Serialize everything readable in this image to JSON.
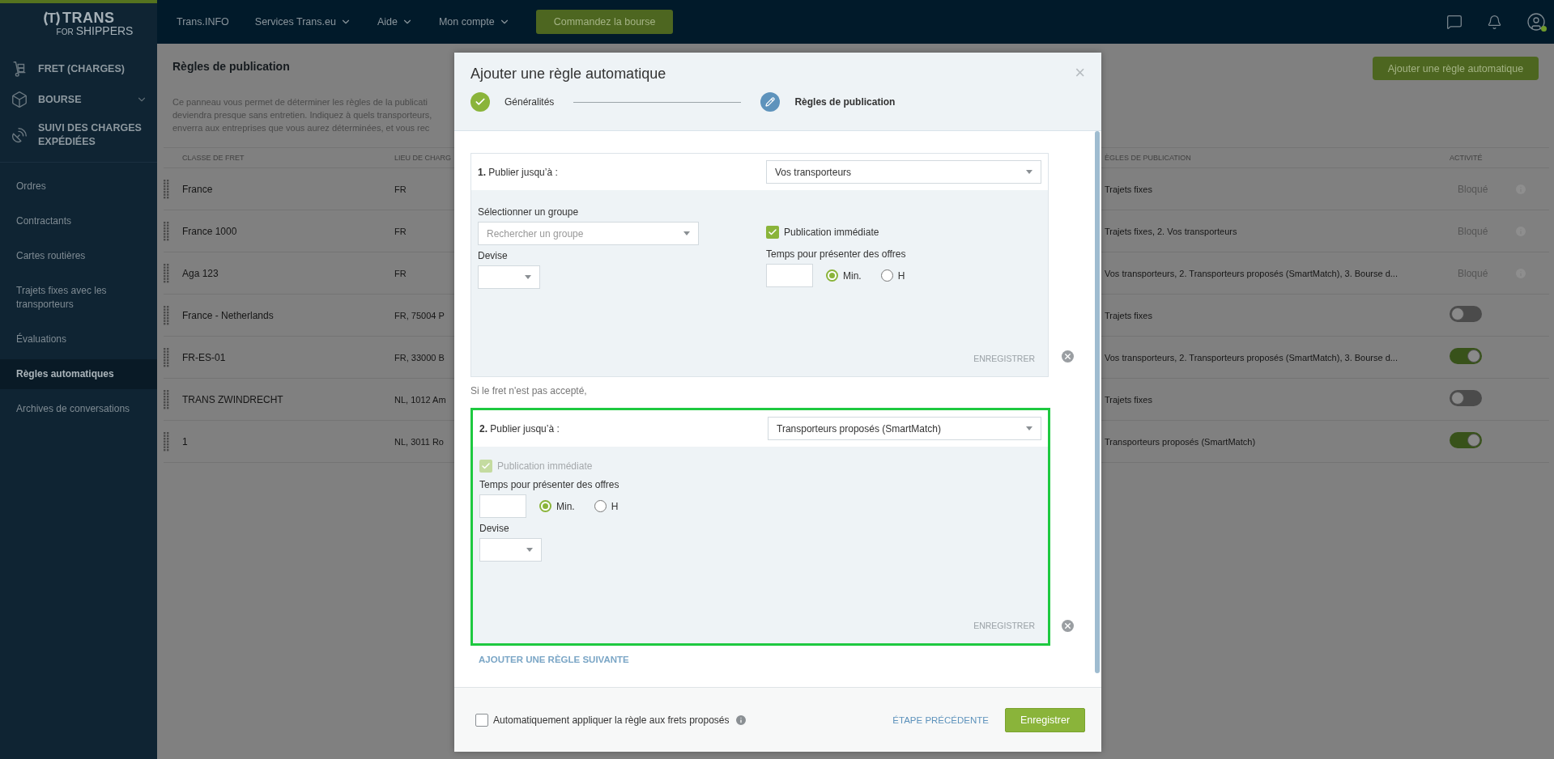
{
  "header": {
    "logo": {
      "mark": "T",
      "name": "TRANS",
      "sub_small": "FOR",
      "sub": "SHIPPERS"
    },
    "menu": [
      {
        "label": "Trans.INFO",
        "dropdown": false
      },
      {
        "label": "Services Trans.eu",
        "dropdown": true
      },
      {
        "label": "Aide",
        "dropdown": true
      },
      {
        "label": "Mon compte",
        "dropdown": true
      }
    ],
    "cta": "Commandez la bourse",
    "user_online": true
  },
  "sidebar": {
    "main": [
      {
        "label": "FRET (CHARGES)",
        "expandable": false
      },
      {
        "label": "BOURSE",
        "expandable": true
      },
      {
        "label": "SUIVI DES CHARGES EXPÉDIÉES",
        "expandable": false
      }
    ],
    "items": [
      {
        "label": "Ordres",
        "selected": false
      },
      {
        "label": "Contractants",
        "selected": false
      },
      {
        "label": "Cartes routières",
        "selected": false
      },
      {
        "label": "Trajets fixes avec les transporteurs",
        "selected": false
      },
      {
        "label": "Évaluations",
        "selected": false
      },
      {
        "label": "Règles automatiques",
        "selected": true
      },
      {
        "label": "Archives de conversations",
        "selected": false
      }
    ]
  },
  "page": {
    "title": "Règles de publication",
    "add_button": "Ajouter une règle automatique",
    "description_lines": [
      "Ce panneau vous permet de déterminer les règles de la publicati",
      "deviendra presque sans entretien. Indiquez à quels transporteurs,",
      "enverra aux entreprises que vous aurez déterminées, et vous rec"
    ],
    "table": {
      "columns": [
        "CLASSE DE FRET",
        "LIEU DE CHARG",
        "ÈGLES DE PUBLICATION",
        "ACTIVITÉ"
      ],
      "rows": [
        {
          "class": "France",
          "place": "FR",
          "rules": "Trajets fixes",
          "activity": {
            "kind": "status",
            "text": "Bloqué"
          }
        },
        {
          "class": "France 1000",
          "place": "FR",
          "rules": "Trajets fixes, 2. Vos transporteurs",
          "activity": {
            "kind": "status",
            "text": "Bloqué"
          }
        },
        {
          "class": "Aga 123",
          "place": "FR",
          "rules": "Vos transporteurs, 2. Transporteurs proposés (SmartMatch), 3. Bourse d...",
          "activity": {
            "kind": "status",
            "text": "Bloqué"
          }
        },
        {
          "class": "France - Netherlands",
          "place": "FR, 75004 P",
          "rules": "Trajets fixes",
          "activity": {
            "kind": "toggle",
            "on": false
          }
        },
        {
          "class": "FR-ES-01",
          "place": "FR, 33000 B",
          "rules": "Vos transporteurs, 2. Transporteurs proposés (SmartMatch), 3. Bourse d...",
          "activity": {
            "kind": "toggle",
            "on": true
          }
        },
        {
          "class": "TRANS ZWINDRECHT",
          "place": "NL, 1012 Am",
          "rules": "Trajets fixes",
          "activity": {
            "kind": "toggle",
            "on": false
          }
        },
        {
          "class": "1",
          "place": "NL, 3011 Ro",
          "rules": "Transporteurs proposés (SmartMatch)",
          "activity": {
            "kind": "toggle",
            "on": true
          }
        }
      ]
    }
  },
  "modal": {
    "title": "Ajouter une règle automatique",
    "close": "×",
    "steps": [
      {
        "label": "Généralités",
        "completed": true,
        "selected": false
      },
      {
        "label": "Règles de publication",
        "completed": false,
        "selected": true
      }
    ],
    "rules": [
      {
        "kind": "group",
        "number": "1.",
        "label": "Publier jusqu’à :",
        "target": "Vos transporteurs",
        "highlighted": false,
        "group_label": "Sélectionner un groupe",
        "group_placeholder": "Rechercher un groupe",
        "currency_label": "Devise",
        "immediate": {
          "label": "Publication immédiate",
          "checked": true,
          "disabled": false
        },
        "time_label": "Temps pour présenter des offres",
        "units": [
          {
            "label": "Min.",
            "selected": true
          },
          {
            "label": "H",
            "selected": false
          }
        ],
        "save": "ENREGISTRER"
      },
      {
        "kind": "simple",
        "number": "2.",
        "label": "Publier jusqu’à :",
        "target": "Transporteurs proposés (SmartMatch)",
        "highlighted": true,
        "currency_label": "Devise",
        "immediate": {
          "label": "Publication immédiate",
          "checked": true,
          "disabled": true
        },
        "time_label": "Temps pour présenter des offres",
        "units": [
          {
            "label": "Min.",
            "selected": true
          },
          {
            "label": "H",
            "selected": false
          }
        ],
        "save": "ENREGISTRER"
      }
    ],
    "fallback_note": "Si le fret n'est pas accepté,",
    "add_rule": "AJOUTER UNE RÈGLE SUIVANTE",
    "auto_apply": {
      "label": "Automatiquement appliquer la règle aux frets proposés",
      "checked": false
    },
    "back": "ÉTAPE PRÉCÉDENTE",
    "submit": "Enregistrer"
  }
}
